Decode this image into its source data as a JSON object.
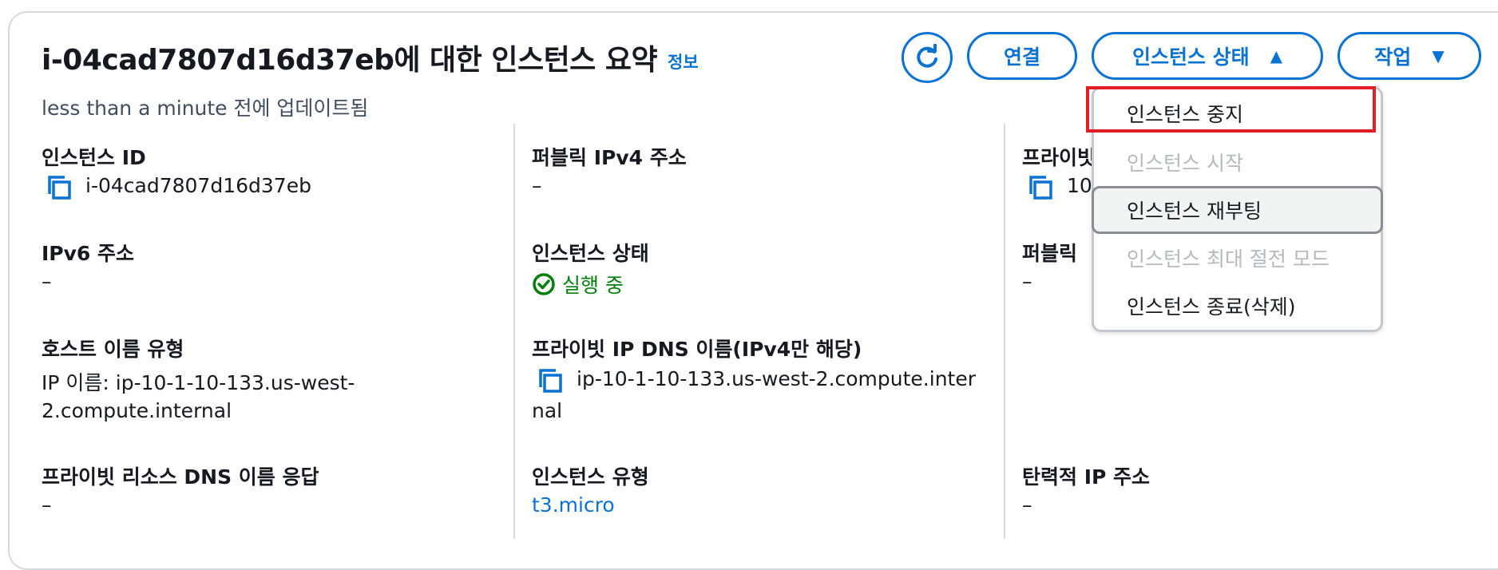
{
  "header": {
    "title": "i-04cad7807d16d37eb에 대한 인스턴스 요약",
    "info": "정보",
    "updated": "less than a minute 전에 업데이트됨"
  },
  "actions": {
    "connect": "연결",
    "instance_state": "인스턴스 상태",
    "actions": "작업"
  },
  "dropdown": {
    "items": [
      {
        "label": "인스턴스 중지",
        "enabled": true
      },
      {
        "label": "인스턴스 시작",
        "enabled": false
      },
      {
        "label": "인스턴스 재부팅",
        "enabled": true
      },
      {
        "label": "인스턴스 최대 절전 모드",
        "enabled": false
      },
      {
        "label": "인스턴스 종료(삭제)",
        "enabled": true
      }
    ]
  },
  "col1": {
    "instance_id_label": "인스턴스 ID",
    "instance_id": "i-04cad7807d16d37eb",
    "ipv6_label": "IPv6 주소",
    "ipv6": "–",
    "hostname_type_label": "호스트 이름 유형",
    "hostname_line1": "IP 이름: ip-10-1-10-133.us-west-",
    "hostname_line2": "2.compute.internal",
    "private_dns_answer_label": "프라이빗 리소스 DNS 이름 응답",
    "private_dns_answer": "–"
  },
  "col2": {
    "public_ipv4_label": "퍼블릭 IPv4 주소",
    "public_ipv4": "–",
    "state_label": "인스턴스 상태",
    "state": "실행 중",
    "private_dns_label": "프라이빗 IP DNS 이름(IPv4만 해당)",
    "private_dns_line1": "ip-10-1-10-133.us-west-2.compute.inter",
    "private_dns_line2": "nal",
    "instance_type_label": "인스턴스 유형",
    "instance_type": "t3.micro"
  },
  "col3": {
    "private_ipv4_label_partial": "프라이빗",
    "private_ipv4_partial": "10",
    "public_dns_label_partial": "퍼블릭",
    "public_dns": "–",
    "elastic_ip_label": "탄력적 IP 주소",
    "elastic_ip": "–"
  },
  "colors": {
    "accent": "#0972d3",
    "success": "#037f0c",
    "highlight": "#e01e25"
  }
}
